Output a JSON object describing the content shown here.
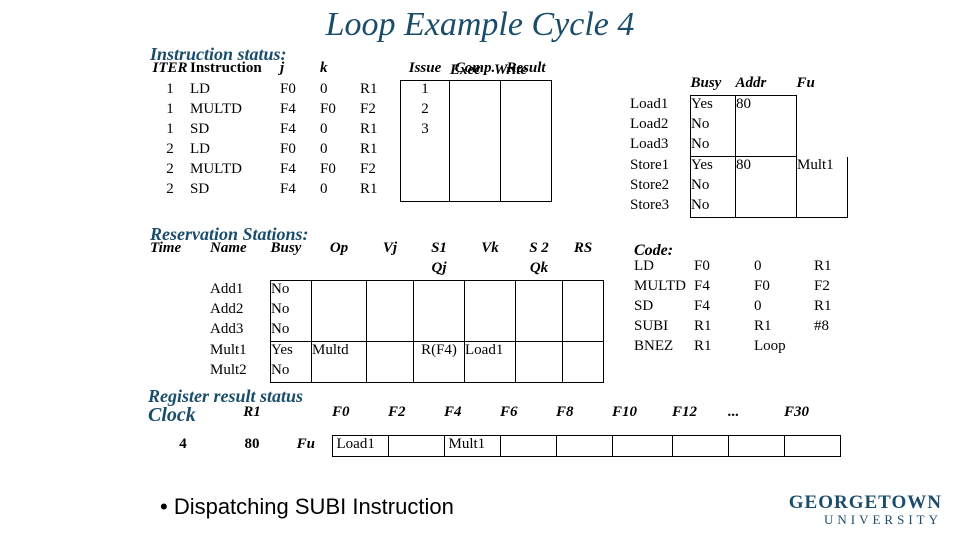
{
  "title": "Loop Example Cycle 4",
  "labels": {
    "instr_status": "Instruction status:",
    "res_stations": "Reservation Stations:",
    "reg_result": "Register result status",
    "clock": "Clock",
    "bullet": "•  Dispatching SUBI Instruction"
  },
  "instr_hdr": {
    "iter": "ITER",
    "instruction": "Instruction",
    "j": "j",
    "k": "k",
    "issue": "Issue",
    "exec": "Exec",
    "comp": "Comp.",
    "write": "Write",
    "result": "Result"
  },
  "instr_rows": [
    {
      "iter": "1",
      "ins": "LD",
      "j": "F0",
      "k": "0",
      "r1": "R1",
      "issue": "1"
    },
    {
      "iter": "1",
      "ins": "MULTD",
      "j": "F4",
      "k": "F0",
      "r1": "F2",
      "issue": "2"
    },
    {
      "iter": "1",
      "ins": "SD",
      "j": "F4",
      "k": "0",
      "r1": "R1",
      "issue": "3"
    },
    {
      "iter": "2",
      "ins": "LD",
      "j": "F0",
      "k": "0",
      "r1": "R1",
      "issue": ""
    },
    {
      "iter": "2",
      "ins": "MULTD",
      "j": "F4",
      "k": "F0",
      "r1": "F2",
      "issue": ""
    },
    {
      "iter": "2",
      "ins": "SD",
      "j": "F4",
      "k": "0",
      "r1": "R1",
      "issue": ""
    }
  ],
  "ls_hdr": {
    "busy": "Busy",
    "addr": "Addr",
    "fu": "Fu"
  },
  "ls_rows": [
    {
      "nm": "Load1",
      "busy": "Yes",
      "addr": "80",
      "fu": ""
    },
    {
      "nm": "Load2",
      "busy": "No",
      "addr": "",
      "fu": ""
    },
    {
      "nm": "Load3",
      "busy": "No",
      "addr": "",
      "fu": ""
    },
    {
      "nm": "Store1",
      "busy": "Yes",
      "addr": "80",
      "fu": "Mult1"
    },
    {
      "nm": "Store2",
      "busy": "No",
      "addr": "",
      "fu": ""
    },
    {
      "nm": "Store3",
      "busy": "No",
      "addr": "",
      "fu": ""
    }
  ],
  "rs_hdr": {
    "time": "Time",
    "name": "Name",
    "busy": "Busy",
    "op": "Op",
    "vj": "Vj",
    "s1": "S1",
    "vk": "Vk",
    "s2": "S 2",
    "qj": "Qj",
    "rs": "RS",
    "qk": "Qk"
  },
  "rs_rows": [
    {
      "name": "Add1",
      "busy": "No",
      "op": "",
      "vj": "",
      "s1": "",
      "vk": "",
      "s2": "",
      "rs": ""
    },
    {
      "name": "Add2",
      "busy": "No",
      "op": "",
      "vj": "",
      "s1": "",
      "vk": "",
      "s2": "",
      "rs": ""
    },
    {
      "name": "Add3",
      "busy": "No",
      "op": "",
      "vj": "",
      "s1": "",
      "vk": "",
      "s2": "",
      "rs": ""
    },
    {
      "name": "Mult1",
      "busy": "Yes",
      "op": "Multd",
      "vj": "",
      "s1": "R(F4)",
      "vk": "Load1",
      "s2": "",
      "rs": ""
    },
    {
      "name": "Mult2",
      "busy": "No",
      "op": "",
      "vj": "",
      "s1": "",
      "vk": "",
      "s2": "",
      "rs": ""
    }
  ],
  "code_hdr": "Code:",
  "code_rows": [
    [
      "LD",
      "F0",
      "0",
      "R1"
    ],
    [
      "MULTD",
      "F4",
      "F0",
      "F2"
    ],
    [
      "SD",
      "F4",
      "0",
      "R1"
    ],
    [
      "SUBI",
      "R1",
      "R1",
      "#8"
    ],
    [
      "BNEZ",
      "R1",
      "Loop",
      ""
    ]
  ],
  "reg": {
    "r1_label": "R1",
    "fu_label": "Fu",
    "clock_val": "4",
    "r1_val": "80",
    "cols": [
      "F0",
      "F2",
      "F4",
      "F6",
      "F8",
      "F10",
      "F12",
      "...",
      "F30"
    ],
    "vals": [
      "Load1",
      "",
      "Mult1",
      "",
      "",
      "",
      "",
      "",
      ""
    ]
  },
  "logo": {
    "l1": "GEORGETOWN",
    "l2": "UNIVERSITY"
  }
}
